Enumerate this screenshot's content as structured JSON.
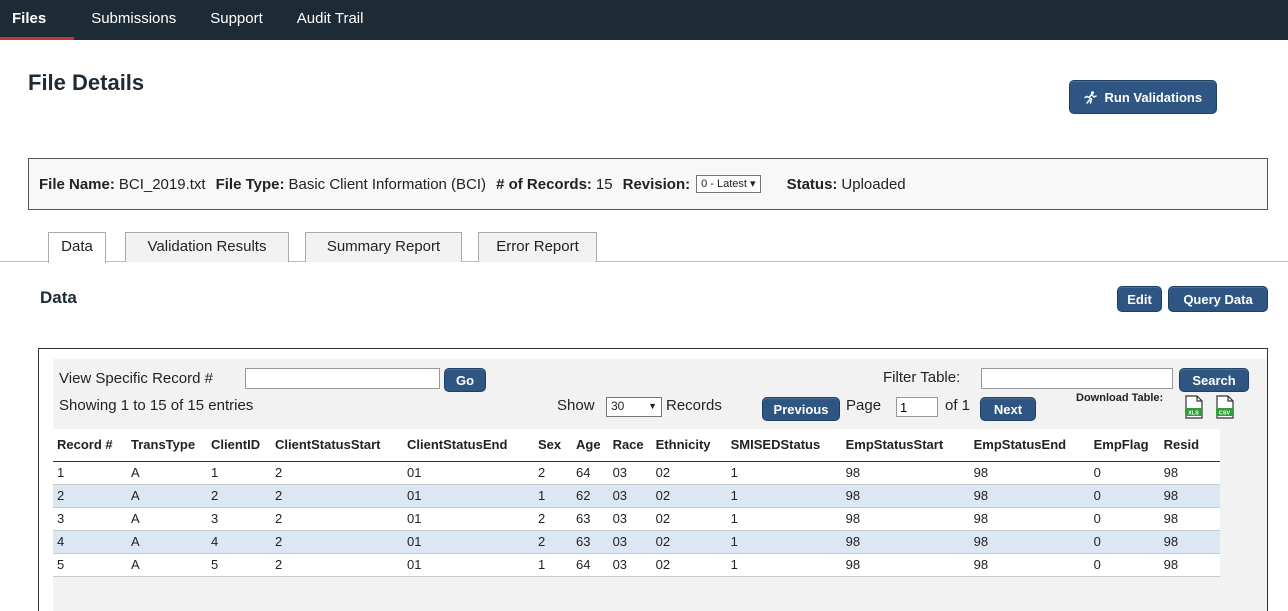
{
  "nav": {
    "items": [
      {
        "label": "Files",
        "active": true
      },
      {
        "label": "Submissions",
        "active": false
      },
      {
        "label": "Support",
        "active": false
      },
      {
        "label": "Audit Trail",
        "active": false
      }
    ]
  },
  "page": {
    "title": "File Details",
    "run_validations_label": "Run Validations",
    "run_icon": "running-person-icon"
  },
  "file_info": {
    "file_name_label": "File Name:",
    "file_name": "BCI_2019.txt",
    "file_type_label": "File Type:",
    "file_type": "Basic Client Information (BCI)",
    "records_label": "# of Records:",
    "records": "15",
    "revision_label": "Revision:",
    "revision_selected": "0 - Latest ▾",
    "status_label": "Status:",
    "status": "Uploaded"
  },
  "tabs": [
    {
      "label": "Data",
      "active": true
    },
    {
      "label": "Validation Results",
      "active": false
    },
    {
      "label": "Summary Report",
      "active": false
    },
    {
      "label": "Error Report",
      "active": false
    }
  ],
  "section": {
    "title": "Data",
    "edit_label": "Edit",
    "query_label": "Query Data"
  },
  "table_controls": {
    "view_record_label": "View Specific Record #",
    "view_record_value": "",
    "go_label": "Go",
    "filter_label": "Filter Table:",
    "filter_value": "",
    "search_label": "Search",
    "showing_text": "Showing 1 to 15 of 15 entries",
    "show_label": "Show",
    "show_selected": "30",
    "records_label": "Records",
    "previous_label": "Previous",
    "page_label": "Page",
    "page_value": "1",
    "of_label": "of 1",
    "next_label": "Next",
    "download_label": "Download Table:",
    "xls_label": "XLS",
    "csv_label": "CSV",
    "colors": {
      "xls": "#2e9e3a",
      "csv": "#2e9e3a"
    }
  },
  "table": {
    "columns": [
      "Record #",
      "TransType",
      "ClientID",
      "ClientStatusStart",
      "ClientStatusEnd",
      "Sex",
      "Age",
      "Race",
      "Ethnicity",
      "SMISEDStatus",
      "EmpStatusStart",
      "EmpStatusEnd",
      "EmpFlag",
      "Resid"
    ],
    "rows": [
      [
        "1",
        "A",
        "1",
        "2",
        "01",
        "2",
        "64",
        "03",
        "02",
        "1",
        "98",
        "98",
        "0",
        "98"
      ],
      [
        "2",
        "A",
        "2",
        "2",
        "01",
        "1",
        "62",
        "03",
        "02",
        "1",
        "98",
        "98",
        "0",
        "98"
      ],
      [
        "3",
        "A",
        "3",
        "2",
        "01",
        "2",
        "63",
        "03",
        "02",
        "1",
        "98",
        "98",
        "0",
        "98"
      ],
      [
        "4",
        "A",
        "4",
        "2",
        "01",
        "2",
        "63",
        "03",
        "02",
        "1",
        "98",
        "98",
        "0",
        "98"
      ],
      [
        "5",
        "A",
        "5",
        "2",
        "01",
        "1",
        "64",
        "03",
        "02",
        "1",
        "98",
        "98",
        "0",
        "98"
      ]
    ]
  },
  "colors": {
    "nav_bg": "#1d2b36",
    "button_bg": "#2f5683",
    "row_alt": "#dbe7f3",
    "active_tab_underline": "#c0392b"
  }
}
